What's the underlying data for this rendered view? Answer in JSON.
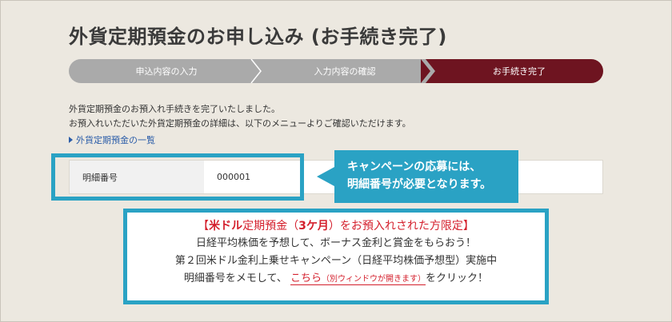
{
  "page": {
    "title": "外貨定期預金のお申し込み (お手続き完了)"
  },
  "steps": [
    {
      "label": "申込内容の入力"
    },
    {
      "label": "入力内容の確認"
    },
    {
      "label": "お手続き完了"
    }
  ],
  "intro": {
    "line1": "外貨定期預金のお預入れ手続きを完了いたしました。",
    "line2": "お預入れいただいた外貨定期預金の詳細は、以下のメニューよりご確認いただけます。"
  },
  "list_link": "外貨定期預金の一覧",
  "detail": {
    "label": "明細番号",
    "value": "000001"
  },
  "callout": {
    "line1": "キャンペーンの応募には、",
    "line2": "明細番号が必要となります。"
  },
  "promo": {
    "head_pre": "【",
    "head_bold1": "米ドル",
    "head_mid1": "定期預金（",
    "head_bold2": "3ケ月",
    "head_post": "）をお預入れされた方限定】",
    "line2": "日経平均株価を予想して、ボーナス金利と賞金をもらおう！",
    "line3": "第２回米ドル金利上乗せキャンペーン（日経平均株価予想型）実施中",
    "line4_pre": "明細番号をメモして、",
    "link_text": "こちら",
    "link_small": "（別ウィンドウが開きます）",
    "line4_post": "をクリック！"
  },
  "colors": {
    "accent": "#2aa2c4",
    "step_active": "#6e1420",
    "step_inactive": "#aaaaaa",
    "promo_red": "#d41f2c",
    "link_blue": "#2a5ca8"
  }
}
